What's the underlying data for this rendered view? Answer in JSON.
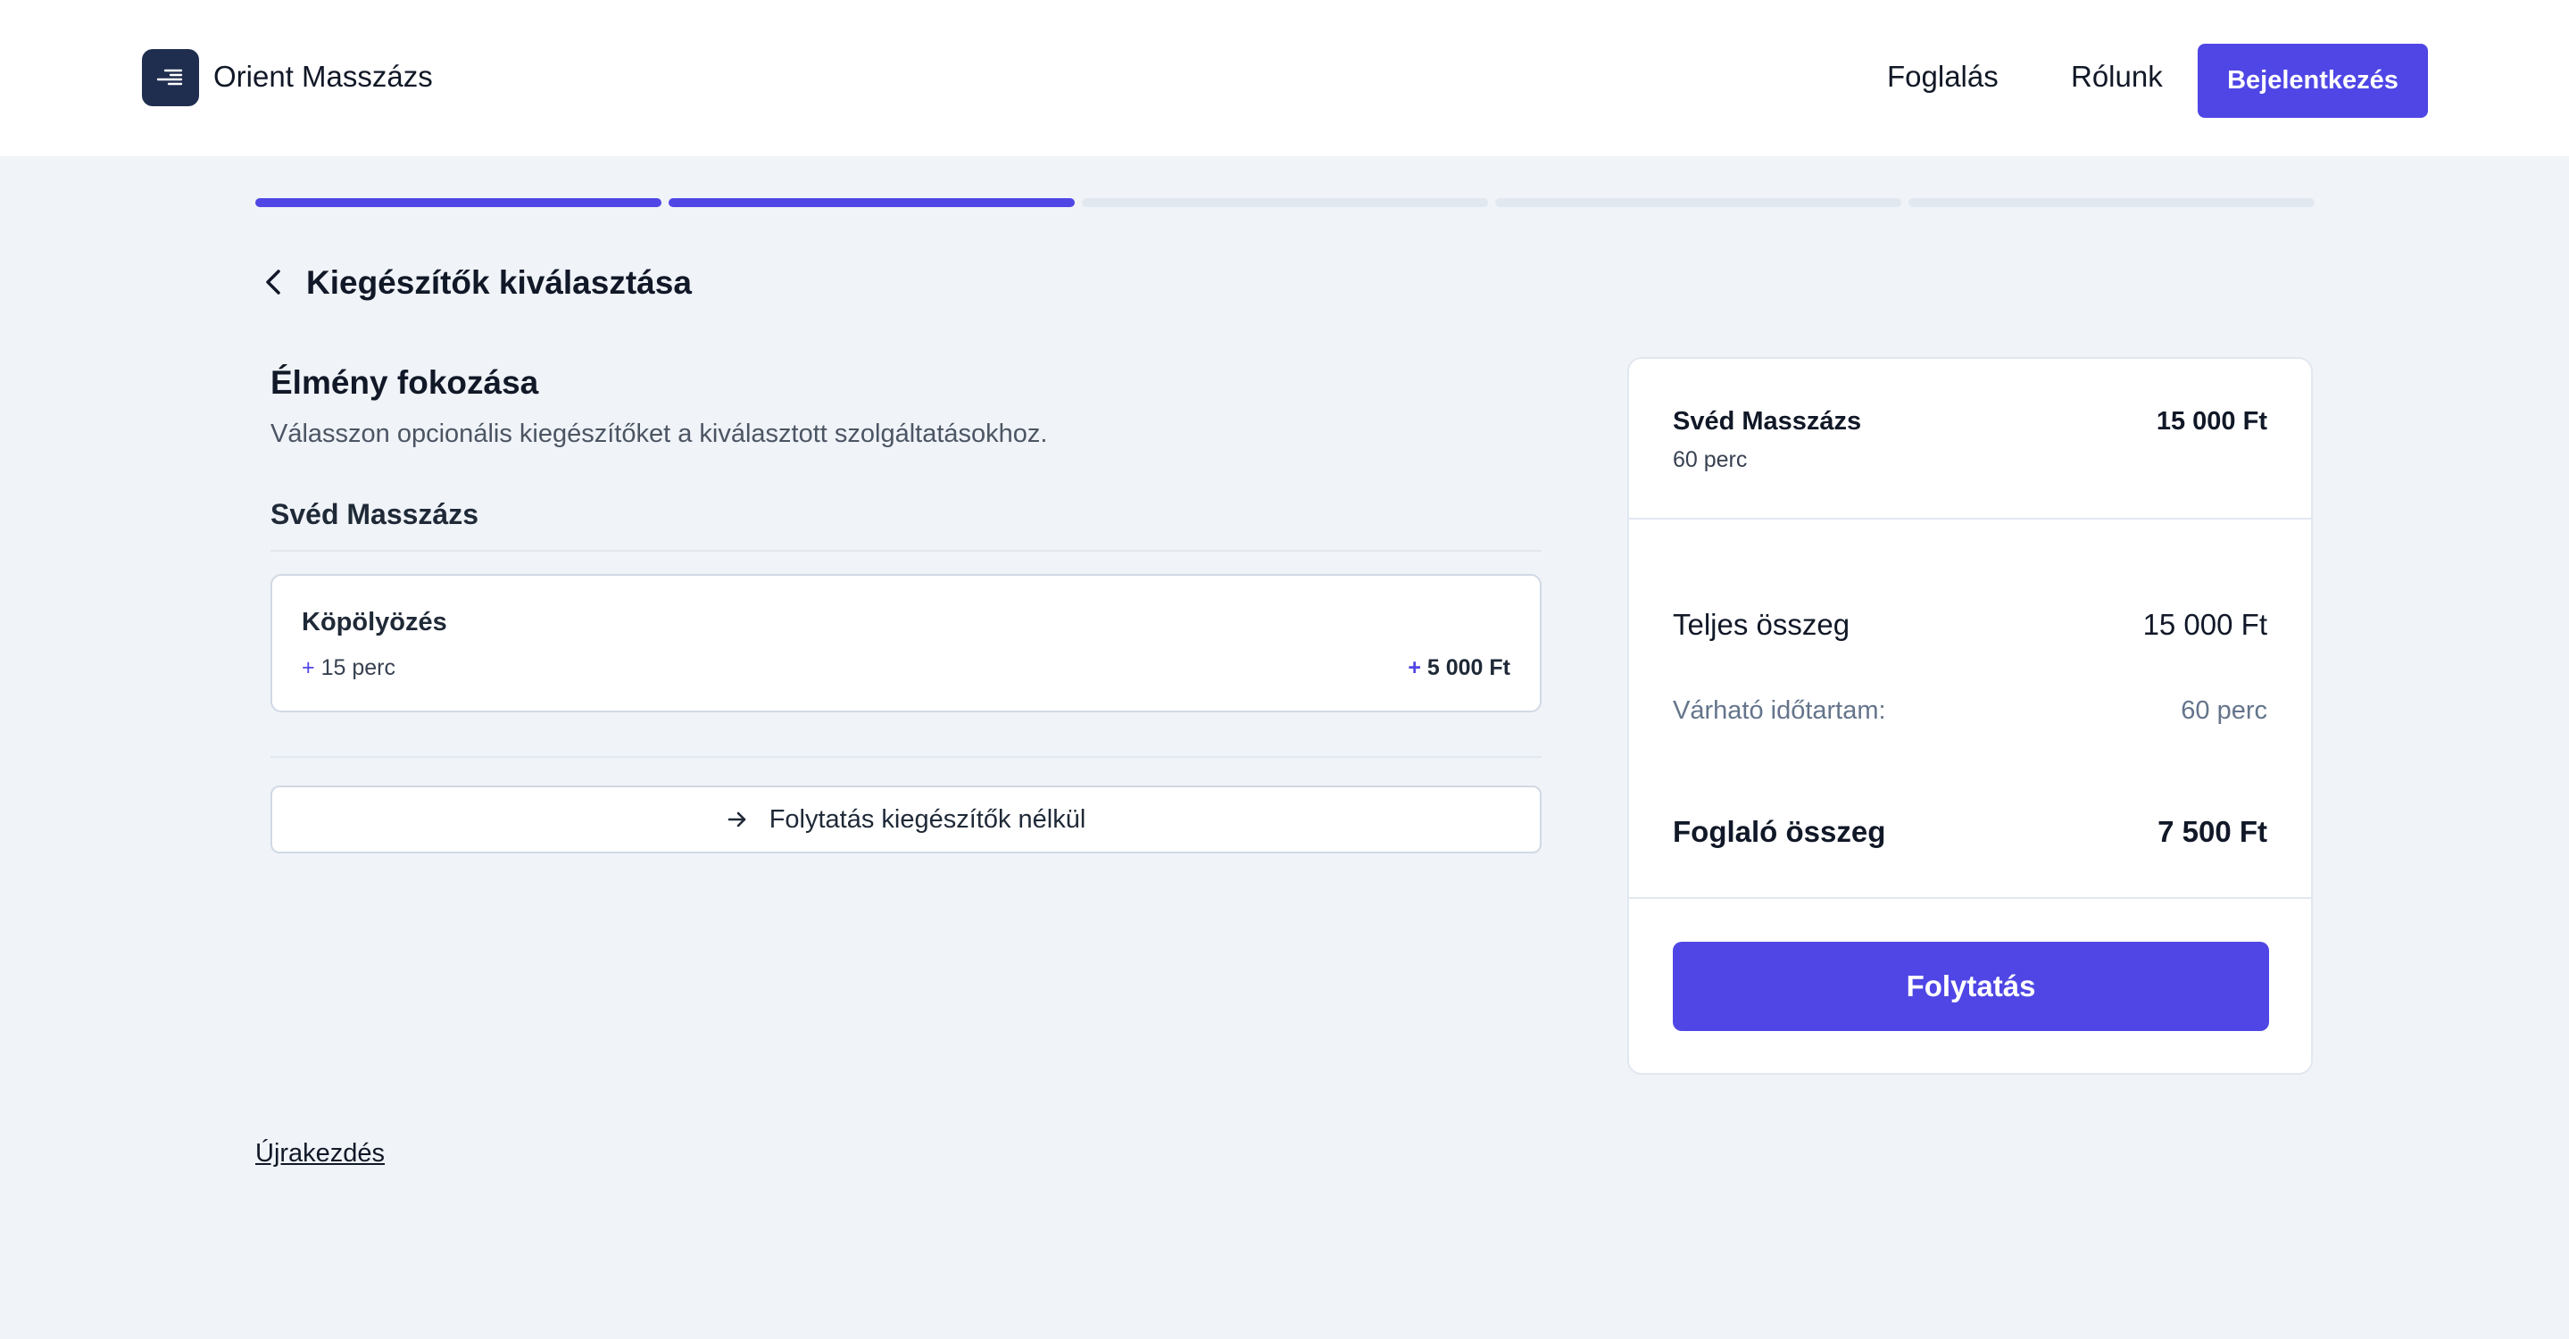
{
  "header": {
    "brand": "Orient Masszázs",
    "nav": [
      {
        "label": "Foglalás"
      },
      {
        "label": "Rólunk"
      }
    ],
    "login_label": "Bejelentkezés",
    "logo_icon": "speed-lines-icon"
  },
  "progress": {
    "steps_total": 5,
    "steps_completed": 2,
    "active_color": "#4f46e5",
    "inactive_color": "#e2e8f0"
  },
  "step": {
    "title": "Kiegészítők kiválasztása",
    "back_icon": "chevron-left-icon"
  },
  "main": {
    "heading": "Élmény fokozása",
    "subheading": "Válasszon opcionális kiegészítőket a kiválasztott szolgáltatásokhoz.",
    "service_group": "Svéd Masszázs",
    "addons": [
      {
        "name": "Köpölyözés",
        "duration": "15 perc",
        "price": "5 000 Ft",
        "prefix": "+"
      }
    ],
    "skip_label": "Folytatás kiegészítők nélkül",
    "skip_icon": "arrow-right-icon"
  },
  "summary": {
    "service_name": "Svéd Masszázs",
    "service_duration": "60 perc",
    "service_price": "15 000 Ft",
    "total_label": "Teljes összeg",
    "total_value": "15 000 Ft",
    "time_label": "Várható időtartam:",
    "time_value": "60 perc",
    "deposit_label": "Foglaló összeg",
    "deposit_value": "7 500 Ft",
    "continue_label": "Folytatás"
  },
  "footer": {
    "restart_label": "Újrakezdés"
  },
  "colors": {
    "accent": "#4f46e5",
    "page_bg": "#f0f3f8",
    "logo_bg": "#1f2d4f"
  }
}
